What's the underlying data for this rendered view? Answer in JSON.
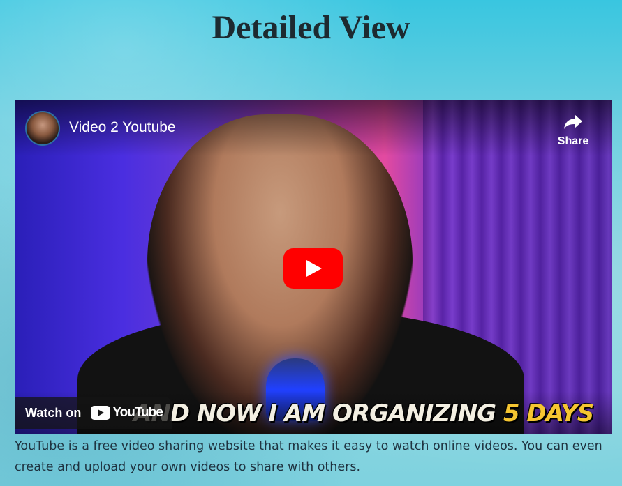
{
  "page": {
    "title": "Detailed View",
    "description": "YouTube is a free video sharing website that makes it easy to watch online videos. You can even create and upload your own videos to share with others."
  },
  "video": {
    "title": "Video 2 Youtube",
    "share_label": "Share",
    "watch_on_label": "Watch on",
    "youtube_wordmark": "YouTube",
    "caption_main": "AND NOW I AM ORGANIZING ",
    "caption_highlight": "5 DAYS"
  },
  "colors": {
    "play_button": "#ff0000",
    "caption_highlight": "#f5c531",
    "title_text": "#1d2a30"
  },
  "icons": {
    "channel_avatar": "avatar",
    "share": "share-arrow-icon",
    "play": "play-icon",
    "youtube_logo": "youtube-logo-icon"
  }
}
